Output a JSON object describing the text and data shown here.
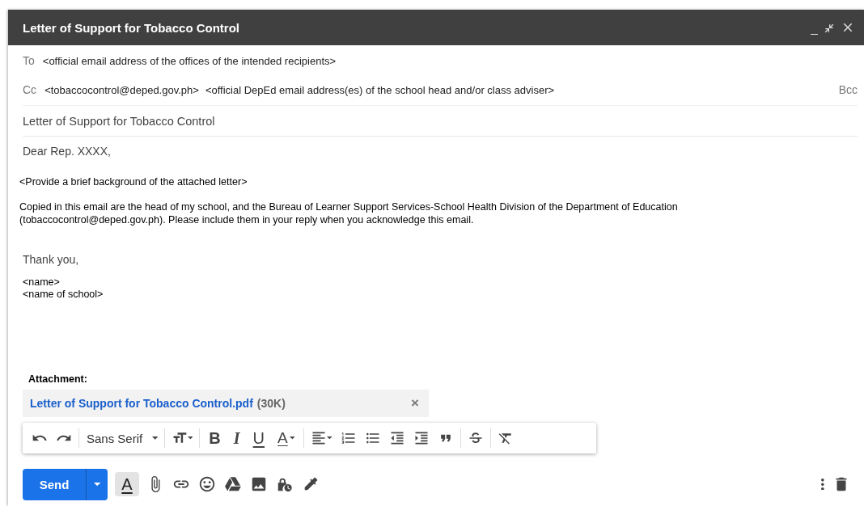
{
  "window": {
    "title": "Letter of Support for Tobacco Control"
  },
  "to": {
    "label": "To",
    "recipients": [
      "<official email address of the offices of the intended recipients>"
    ]
  },
  "cc": {
    "label": "Cc",
    "recipients": [
      "<tobaccocontrol@deped.gov.ph>",
      "<official DepEd email address(es) of the school head and/or class adviser>"
    ],
    "bcc_link": "Bcc"
  },
  "subject": "Letter of Support for Tobacco Control",
  "body": [
    {
      "kind": "greeting",
      "lines": [
        "Dear Rep. XXXX,"
      ]
    },
    {
      "kind": "plain",
      "lines": [
        "<Provide a brief background of the attached letter>"
      ]
    },
    {
      "kind": "plain",
      "lines": [
        "Copied in this email are the head of my school, and the Bureau of Learner Support Services-School Health Division of the Department of Education",
        "(tobaccocontrol@deped.gov.ph). Please include them in your reply when you acknowledge this email."
      ]
    },
    {
      "kind": "closing",
      "lines": [
        "Thank you,"
      ]
    },
    {
      "kind": "signature",
      "lines": [
        "<name>",
        "<name of school>"
      ]
    }
  ],
  "attachment": {
    "label": "Attachment:",
    "file_name": "Letter of Support for Tobacco Control.pdf",
    "size": "(30K)",
    "remove": "×"
  },
  "format_toolbar": {
    "font": "Sans Serif",
    "bold": "B",
    "italic": "I",
    "underline": "U",
    "text_color": "A"
  },
  "bottom_bar": {
    "send": "Send",
    "formatting_toggle": {
      "label": "A",
      "selected": true
    }
  }
}
